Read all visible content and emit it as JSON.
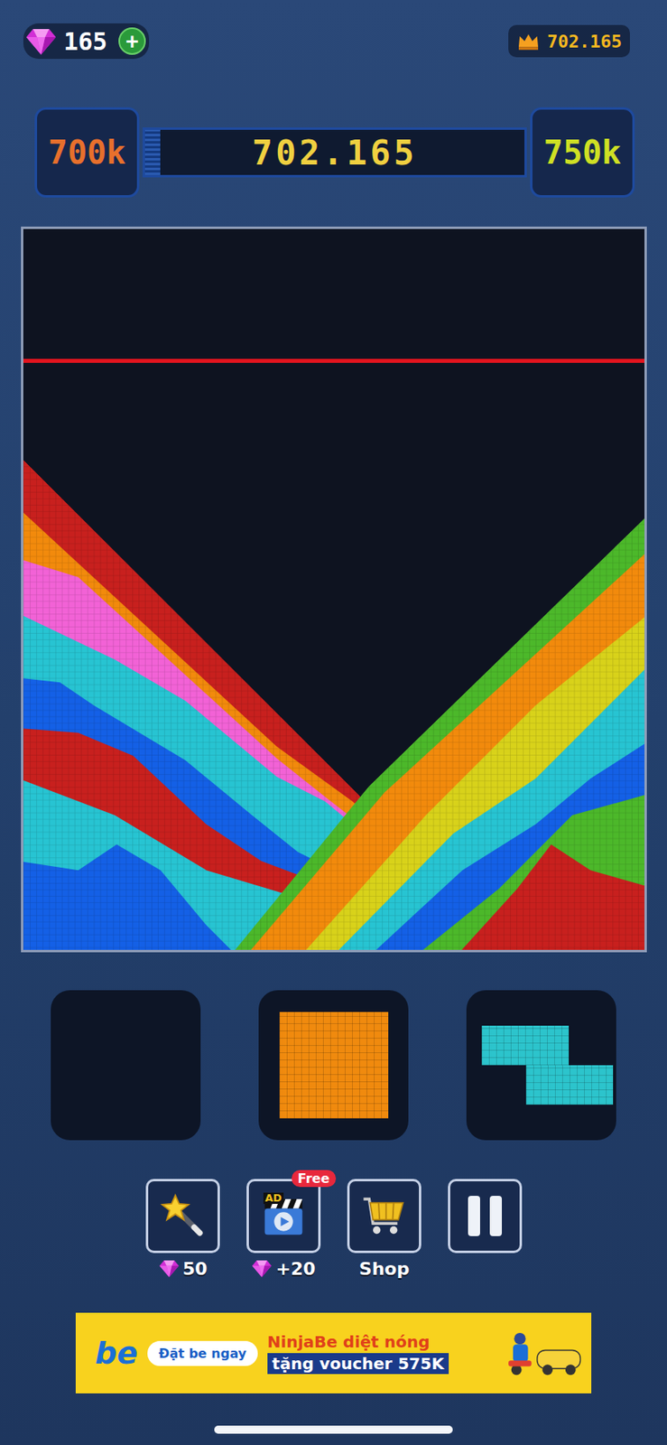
{
  "currency": {
    "gems": "165",
    "add_button": "+"
  },
  "best_score": "702.165",
  "progress": {
    "current_milestone": "700k",
    "score": "702.165",
    "next_milestone": "750k",
    "level": 0.04
  },
  "board": {
    "left_bands": [
      {
        "color": "#c8201e"
      },
      {
        "color": "#f28a0c"
      },
      {
        "color": "#f262d6"
      },
      {
        "color": "#27c4d2"
      },
      {
        "color": "#1460e6"
      },
      {
        "color": "#c8201e"
      },
      {
        "color": "#27c4d2"
      },
      {
        "color": "#1460e6"
      }
    ],
    "right_bands": [
      {
        "color": "#4cb82a"
      },
      {
        "color": "#f28a0c"
      },
      {
        "color": "#d8d21a"
      },
      {
        "color": "#27c4d2"
      },
      {
        "color": "#1460e6"
      },
      {
        "color": "#4cb82a"
      },
      {
        "color": "#c8201e"
      }
    ]
  },
  "pieces": [
    {
      "kind": "empty"
    },
    {
      "kind": "square",
      "color": "#f08a0e"
    },
    {
      "kind": "z",
      "color": "#2cc4cc"
    }
  ],
  "tools": [
    {
      "kind": "wand",
      "label": "50",
      "gem": true
    },
    {
      "kind": "ad",
      "label": "+20",
      "gem": true,
      "badge": "Free",
      "icon_text": "AD"
    },
    {
      "kind": "shop",
      "label": "Shop",
      "gem": false
    },
    {
      "kind": "pause",
      "gem": false
    }
  ],
  "ad": {
    "logo": "be",
    "button": "Đặt be ngay",
    "headline": "NinjaBe diệt nóng",
    "subline": "tặng voucher 575K"
  }
}
